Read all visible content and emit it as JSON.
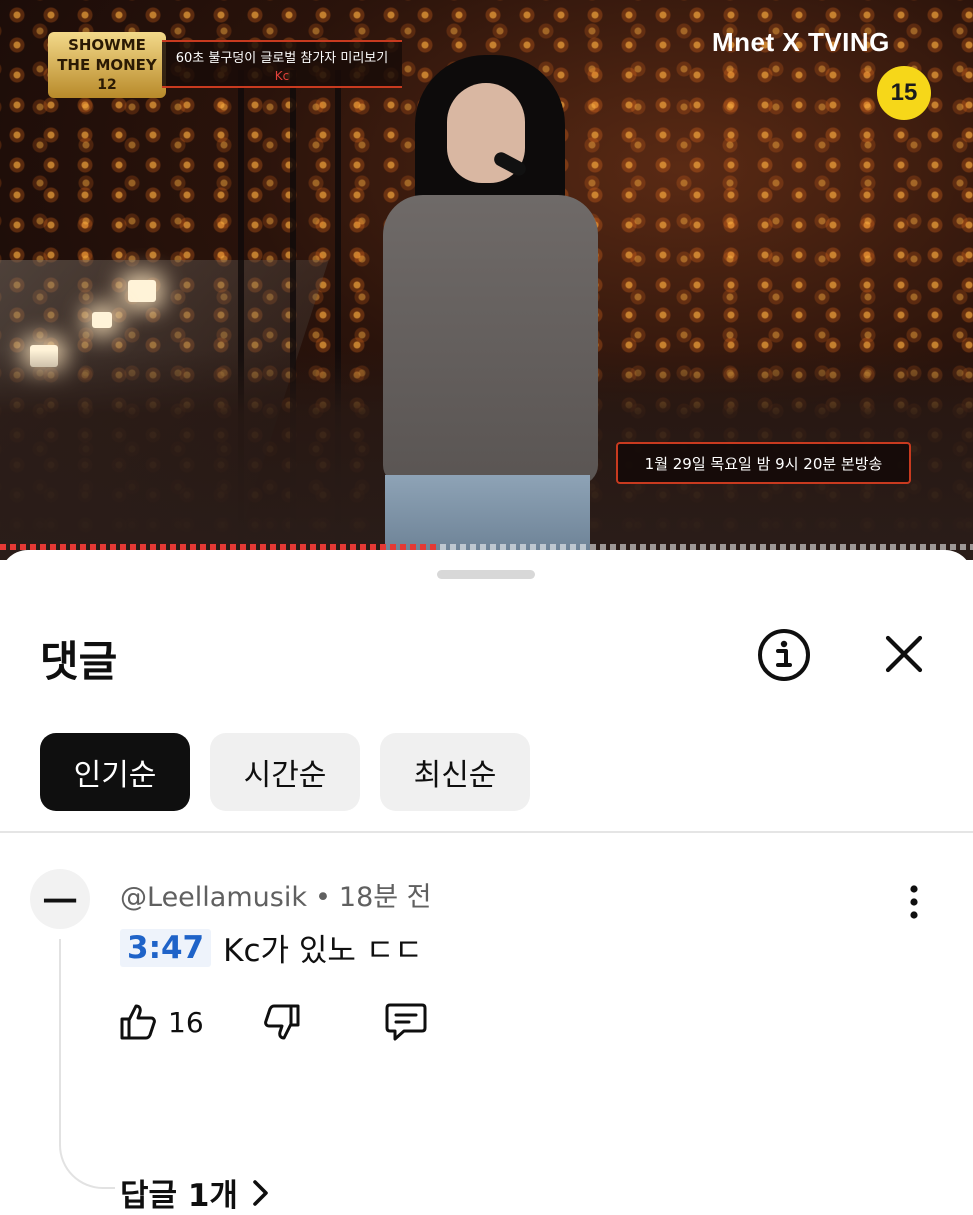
{
  "video": {
    "show_logo": [
      "SHOWME",
      "THE MONEY",
      "12"
    ],
    "caption_title": "60초 불구덩이 글로벌 참가자 미리보기",
    "caption_name": "Kc",
    "brand": "Mnet X TVING",
    "age_rating": "15",
    "air_date": "1월 29일 목요일 밤 9시 20분 본방송",
    "progress_fraction": 0.45,
    "accent_color": "#e53935"
  },
  "sheet": {
    "title": "댓글",
    "info_icon": "info-circle-icon",
    "close_icon": "close-icon",
    "sort_chips": [
      {
        "label": "인기순",
        "selected": true
      },
      {
        "label": "시간순",
        "selected": false
      },
      {
        "label": "최신순",
        "selected": false
      }
    ]
  },
  "comments": [
    {
      "avatar_glyph": "一",
      "author": "@Leellamusik",
      "time": "18분 전",
      "timestamp_link": "3:47",
      "text": "Kc가 있노 ㄷㄷ",
      "likes": "16",
      "replies_label": "답글 1개"
    }
  ]
}
